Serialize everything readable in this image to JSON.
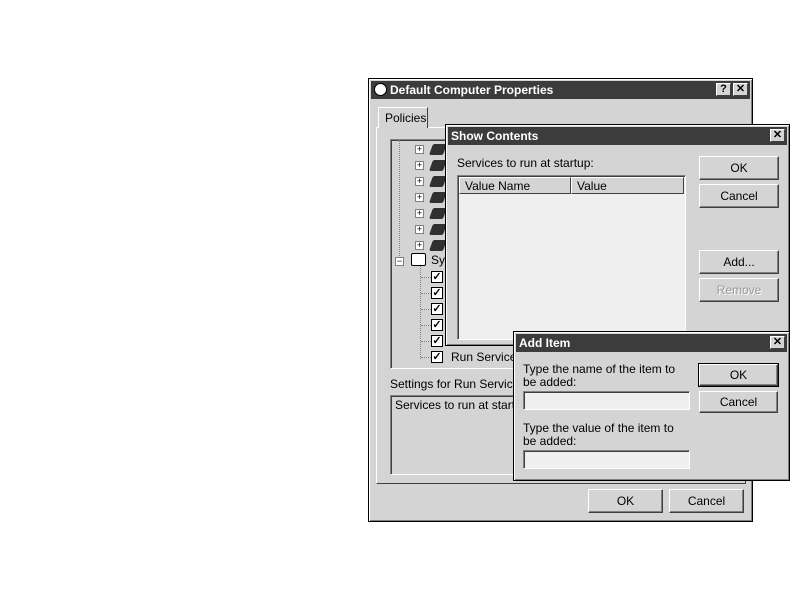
{
  "main_window": {
    "title": "Default Computer Properties",
    "help_button": "?",
    "close_button": "✕",
    "tab_policies": "Policies",
    "tree_partial_label": "Sy",
    "tree_selected_item": "Run Services",
    "settings_label": "Settings for Run Services",
    "settings_value": "Services to run at startup",
    "ok_label": "OK",
    "cancel_label": "Cancel"
  },
  "show_contents": {
    "title": "Show Contents",
    "close_button": "✕",
    "description": "Services to run at startup:",
    "columns": [
      "Value Name",
      "Value"
    ],
    "ok_label": "OK",
    "cancel_label": "Cancel",
    "add_label": "Add...",
    "remove_label": "Remove"
  },
  "add_item": {
    "title": "Add Item",
    "close_button": "✕",
    "name_prompt": "Type the name of the item to be added:",
    "value_prompt": "Type the value of the item to be added:",
    "name_value": "",
    "value_value": "",
    "ok_label": "OK",
    "cancel_label": "Cancel"
  }
}
